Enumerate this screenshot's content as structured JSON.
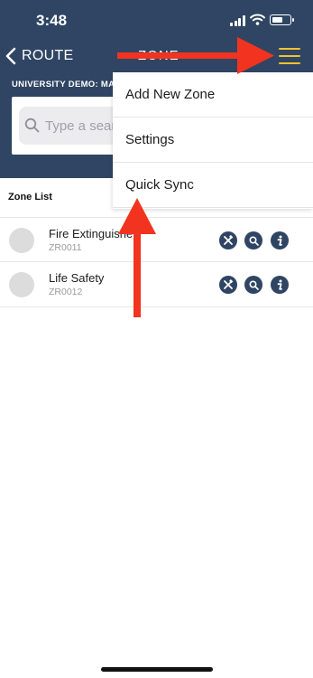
{
  "status_bar": {
    "time": "3:48"
  },
  "nav": {
    "back_label": "ROUTE",
    "title": "ZONE"
  },
  "header": {
    "site_name": "UNIVERSITY DEMO: MAIN",
    "search_placeholder": "Type a search"
  },
  "zone_list": {
    "title": "Zone List",
    "items": [
      {
        "name": "Fire Extinguisher",
        "code": "ZR0011"
      },
      {
        "name": "Life Safety",
        "code": "ZR0012"
      }
    ]
  },
  "menu": {
    "items": [
      {
        "label": "Add New Zone"
      },
      {
        "label": "Settings"
      },
      {
        "label": "Quick Sync"
      }
    ]
  },
  "colors": {
    "header_bg": "#2f4563",
    "menu_icon": "#f1c232",
    "annotation_arrow": "#f2331f",
    "action_button": "#2f4563"
  },
  "icons": [
    "chevron-left-icon",
    "hamburger-menu-icon",
    "search-icon",
    "tools-icon",
    "magnifier-icon",
    "info-icon"
  ]
}
